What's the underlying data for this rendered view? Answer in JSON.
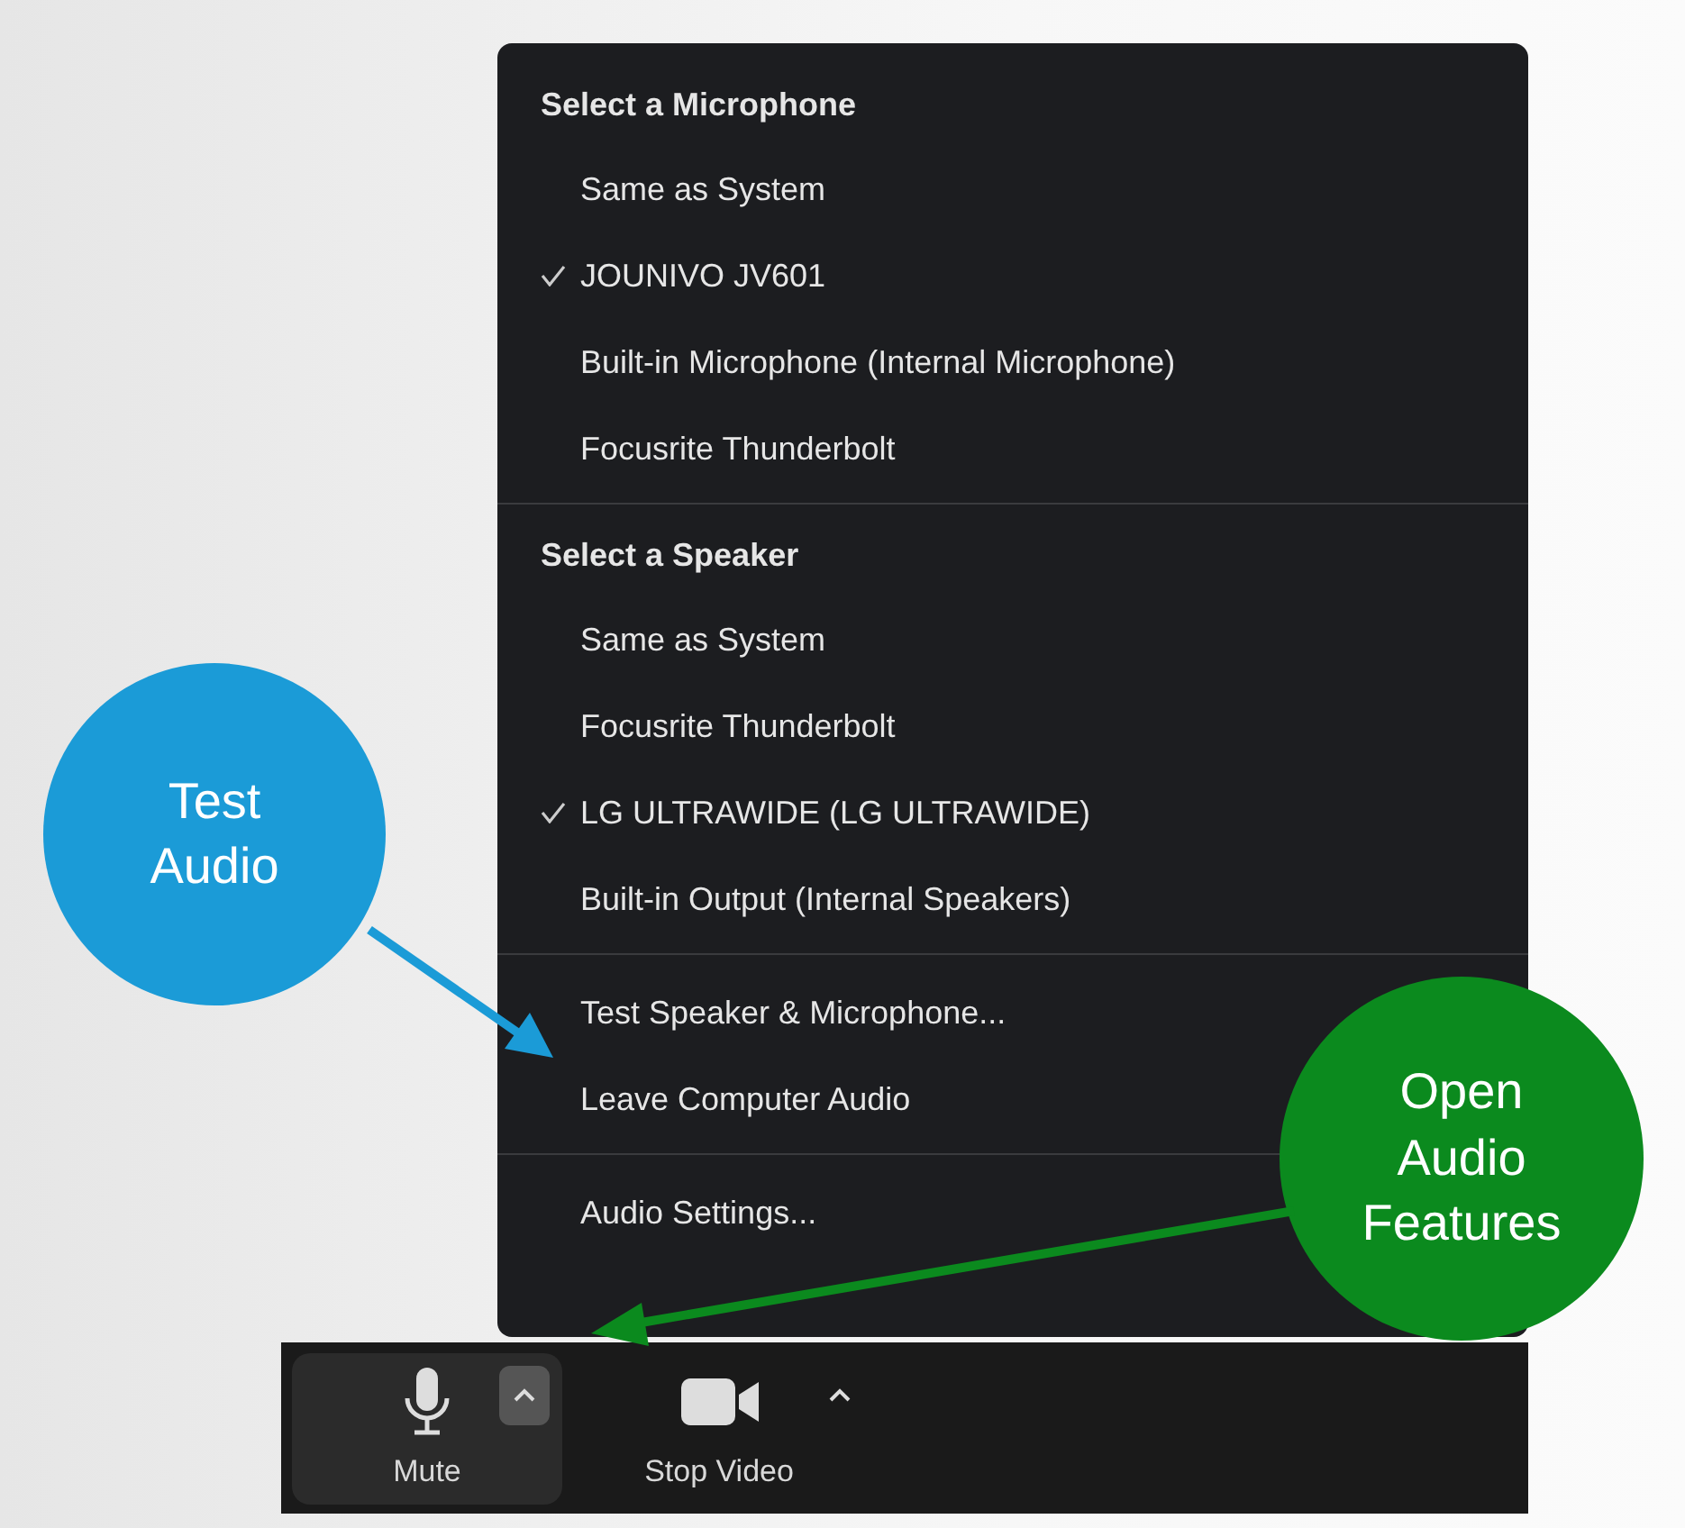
{
  "menu": {
    "sections": [
      {
        "title": "Select a Microphone",
        "items": [
          {
            "label": "Same as System",
            "selected": false
          },
          {
            "label": "JOUNIVO JV601",
            "selected": true
          },
          {
            "label": "Built-in Microphone (Internal Microphone)",
            "selected": false
          },
          {
            "label": "Focusrite Thunderbolt",
            "selected": false
          }
        ]
      },
      {
        "title": "Select a Speaker",
        "items": [
          {
            "label": "Same as System",
            "selected": false
          },
          {
            "label": "Focusrite Thunderbolt",
            "selected": false
          },
          {
            "label": "LG ULTRAWIDE (LG ULTRAWIDE)",
            "selected": true
          },
          {
            "label": "Built-in Output (Internal Speakers)",
            "selected": false
          }
        ]
      },
      {
        "items": [
          {
            "label": "Test Speaker & Microphone..."
          },
          {
            "label": "Leave Computer Audio"
          }
        ]
      },
      {
        "items": [
          {
            "label": "Audio Settings..."
          }
        ]
      }
    ]
  },
  "toolbar": {
    "buttons": [
      {
        "label": "Mute",
        "kind": "microphone",
        "highlighted": true
      },
      {
        "label": "Stop Video",
        "kind": "camera",
        "highlighted": false
      }
    ]
  },
  "callouts": [
    {
      "text": "Test Audio",
      "color": "#1b9bd7"
    },
    {
      "text": "Open Audio Features",
      "color": "#0b8a1e"
    }
  ]
}
